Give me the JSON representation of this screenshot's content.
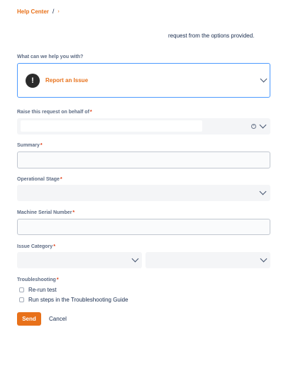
{
  "breadcrumb": {
    "link": "Help Center",
    "separator": "/",
    "chevron": "›"
  },
  "intro": {
    "text": "request from the options provided."
  },
  "request_type": {
    "label": "What can we help you with?",
    "selected": "Report an Issue",
    "icon": "exclamation-icon",
    "icon_glyph": "!"
  },
  "fields": {
    "behalf": {
      "label": "Raise this request on behalf of",
      "required": "*",
      "clear_glyph": "×"
    },
    "summary": {
      "label": "Summary",
      "required": "*"
    },
    "stage": {
      "label": "Operational Stage",
      "required": "*"
    },
    "serial": {
      "label": "Machine Serial Number",
      "required": "*"
    },
    "category": {
      "label": "Issue Category",
      "required": "*"
    },
    "troubleshooting": {
      "label": "Troubleshooting",
      "required": "*",
      "options": [
        "Re-run test",
        "Run steps in the Troubleshooting Guide"
      ]
    }
  },
  "actions": {
    "send": "Send",
    "cancel": "Cancel"
  },
  "colors": {
    "accent": "#e8711a",
    "required": "#de350b",
    "focus": "#4c9aff",
    "text": "#172b4d"
  }
}
